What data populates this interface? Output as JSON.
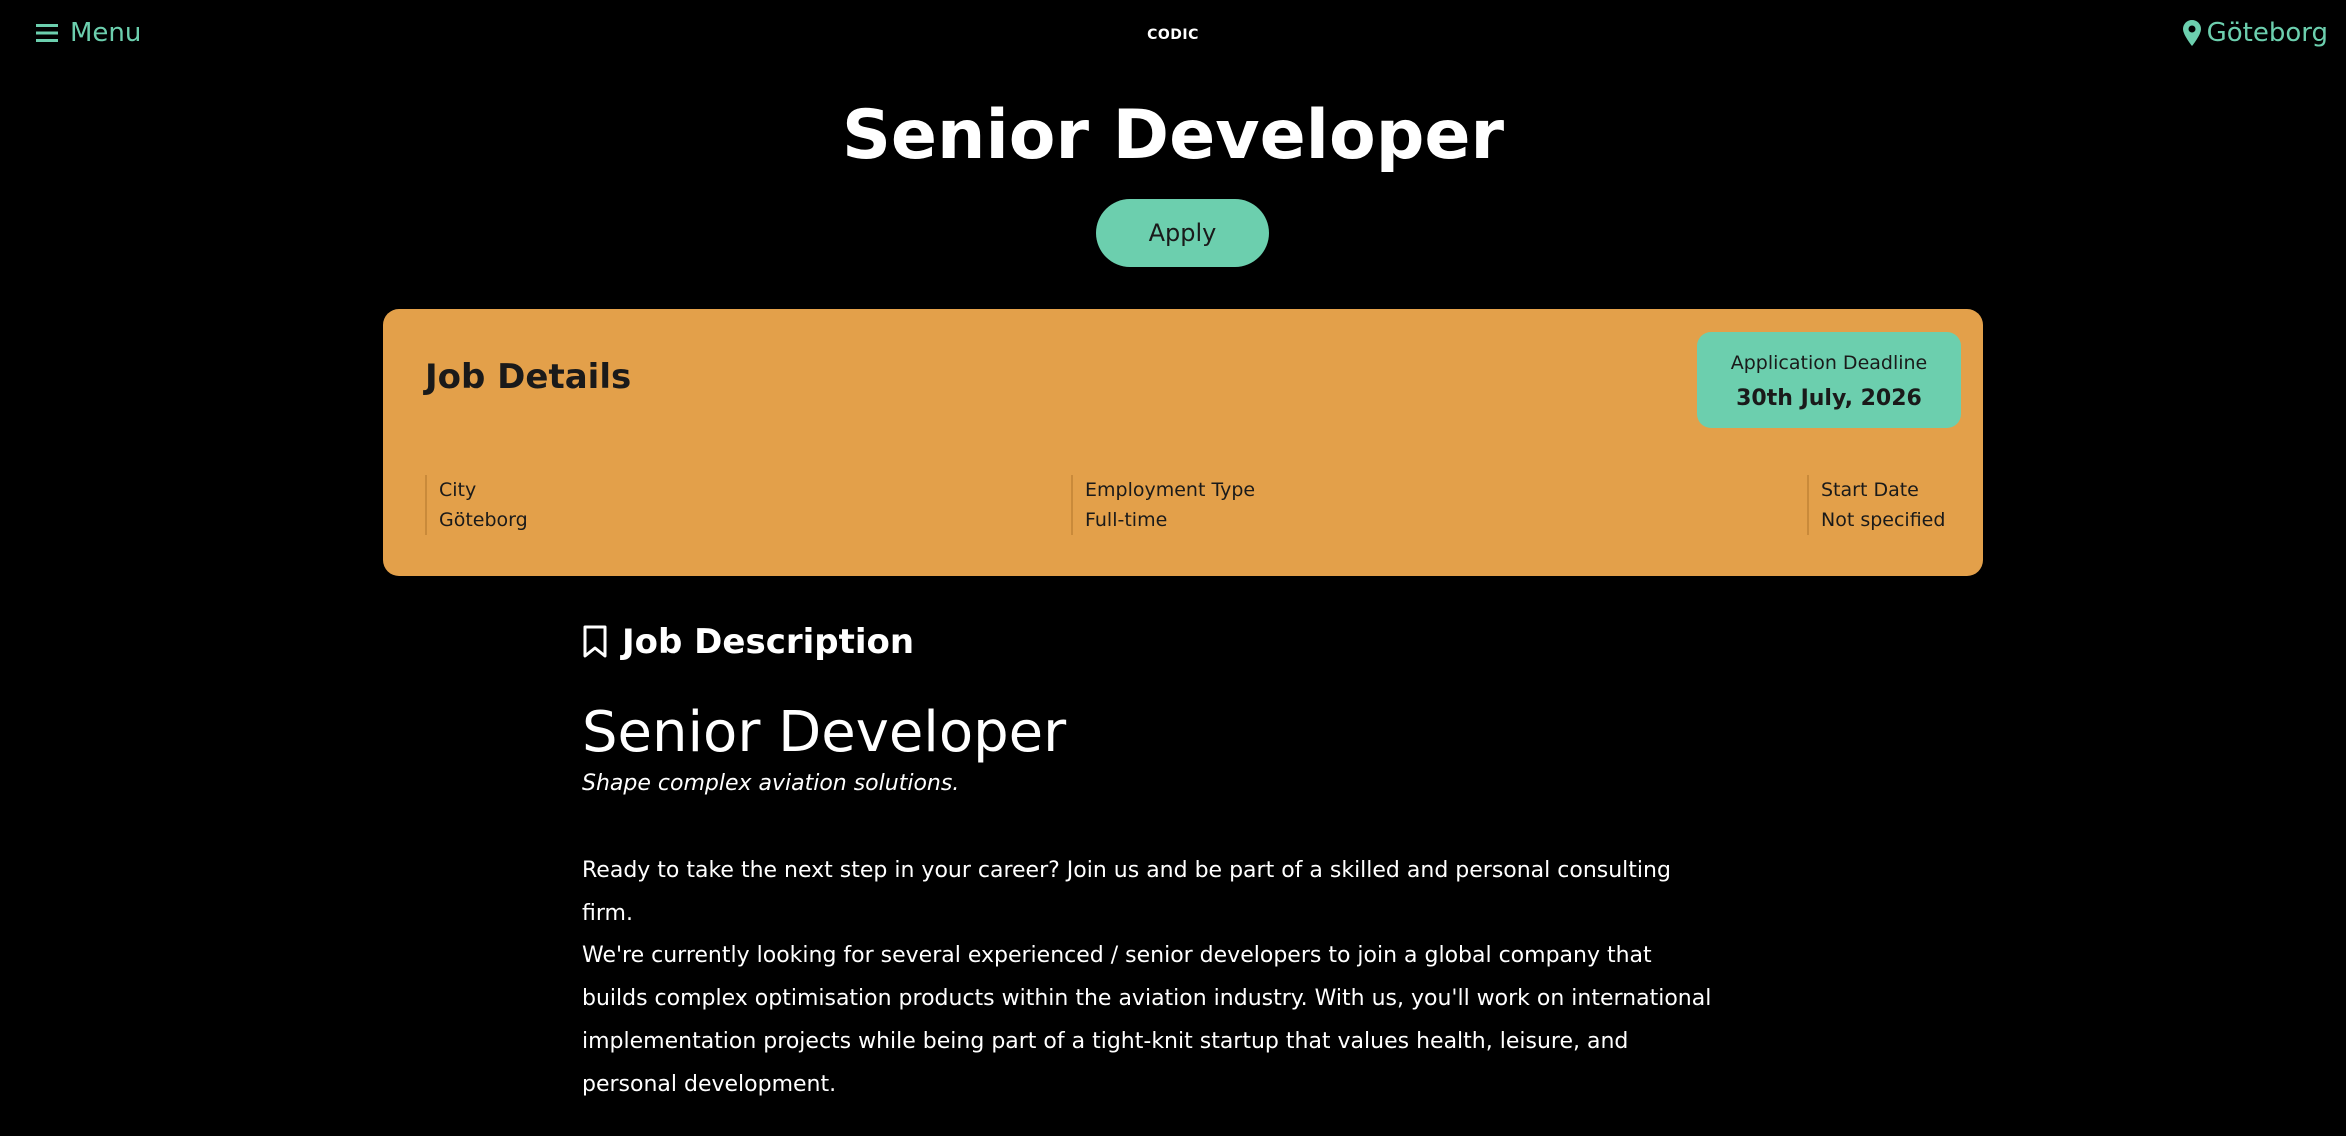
{
  "header": {
    "menu_label": "Menu",
    "logo_text": "CODIC",
    "location_label": "Göteborg"
  },
  "hero": {
    "title": "Senior Developer",
    "apply_label": "Apply"
  },
  "job_details": {
    "title": "Job Details",
    "deadline_label": "Application Deadline",
    "deadline_value": "30th July, 2026",
    "items": [
      {
        "label": "City",
        "value": "Göteborg"
      },
      {
        "label": "Employment Type",
        "value": "Full-time"
      },
      {
        "label": "Start Date",
        "value": "Not specified"
      }
    ]
  },
  "description": {
    "heading": "Job Description",
    "title": "Senior Developer",
    "tagline": "Shape complex aviation solutions.",
    "paragraphs": [
      "Ready to take the next step in your career? Join us and be part of a skilled and personal consulting firm.",
      "We're currently looking for several experienced / senior developers to join a global company that builds complex optimisation products within the aviation industry. With us, you'll work on international implementation projects while being part of a tight-knit startup that values health, leisure, and personal development."
    ]
  },
  "colors": {
    "accent": "#6ccfae",
    "card": "#e3a04a",
    "background": "#000000"
  },
  "icons": [
    "hamburger-icon",
    "map-pin-icon",
    "bookmark-icon"
  ]
}
